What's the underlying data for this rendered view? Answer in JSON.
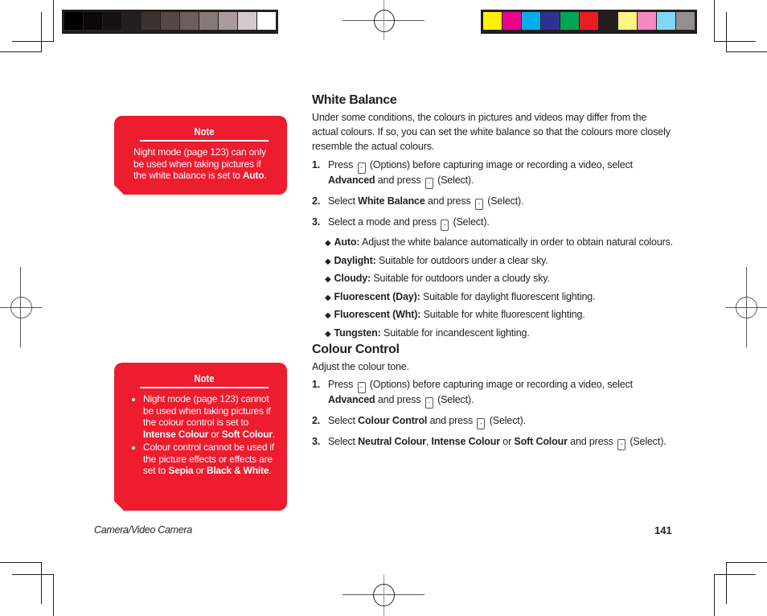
{
  "color_bars": {
    "grayscale": [
      "#000000",
      "#0a0908",
      "#151210",
      "#231f1d",
      "#3c3330",
      "#544845",
      "#6a5f5b",
      "#857a76",
      "#a89d9a",
      "#d3cac9",
      "#ffffff"
    ],
    "process": [
      "#fff100",
      "#ec008c",
      "#00aeef",
      "#2e3192",
      "#00a651",
      "#ed1c24",
      "#231f20",
      "#fff685",
      "#f587c3",
      "#7fd6f7",
      "#918f8f"
    ]
  },
  "note1": {
    "title": "Note",
    "text_before": "Night mode (page 123) can only be used when taking pictures if the white balance is set to ",
    "bold": "Auto",
    "text_after": "."
  },
  "note2": {
    "title": "Note",
    "items": [
      {
        "t1": "Night mode (page 123) cannot be used when taking pictures if the colour control is set to ",
        "b1": "Intense Colour",
        "t2": " or ",
        "b2": "Soft Colour",
        "t3": "."
      },
      {
        "t1": "Colour control cannot be used if the picture effects or effects are set to ",
        "b1": "Sepia",
        "t2": " or ",
        "b2": "Black & White",
        "t3": "."
      }
    ]
  },
  "white_balance": {
    "heading": "White Balance",
    "intro": "Under some conditions, the colours in pictures and videos may differ from the actual colours. If so, you can set the white balance so that the colours more closely resemble the actual colours.",
    "steps": [
      {
        "num": "1.",
        "a": "Press ",
        "b": " (Options) before capturing image or recording a video, select ",
        "bold": "Advanced",
        "c": " and press ",
        "d": " (Select)."
      },
      {
        "num": "2.",
        "a": "Select ",
        "bold": "White Balance",
        "b": " and press ",
        "c": " (Select)."
      },
      {
        "num": "3.",
        "a": "Select a mode and press ",
        "b": " (Select)."
      }
    ],
    "modes": [
      {
        "label": "Auto:",
        "desc": " Adjust the white balance automatically in order to obtain natural colours."
      },
      {
        "label": "Daylight:",
        "desc": " Suitable for outdoors under a clear sky."
      },
      {
        "label": "Cloudy:",
        "desc": " Suitable for outdoors under a cloudy sky."
      },
      {
        "label": "Fluorescent (Day):",
        "desc": " Suitable for daylight fluorescent lighting."
      },
      {
        "label": "Fluorescent (Wht):",
        "desc": " Suitable for white fluorescent lighting."
      },
      {
        "label": "Tungsten:",
        "desc": " Suitable for incandescent lighting."
      }
    ]
  },
  "colour_control": {
    "heading": "Colour Control",
    "intro": "Adjust the colour tone.",
    "steps": [
      {
        "num": "1.",
        "a": "Press ",
        "b": " (Options) before capturing image or recording a video, select ",
        "bold": "Advanced",
        "c": " and press ",
        "d": " (Select)."
      },
      {
        "num": "2.",
        "a": "Select ",
        "bold": "Colour Control",
        "b": " and press ",
        "c": " (Select)."
      },
      {
        "num": "3.",
        "a": "Select ",
        "bold1": "Neutral Colour",
        "sep1": ", ",
        "bold2": "Intense Colour",
        "sep2": " or ",
        "bold3": "Soft Colour",
        "b": " and press ",
        "c": " (Select)."
      }
    ]
  },
  "icons": {
    "key": "-",
    "diamond": "◆",
    "bullet": "•"
  },
  "footer": {
    "section": "Camera/Video Camera",
    "page": "141"
  }
}
